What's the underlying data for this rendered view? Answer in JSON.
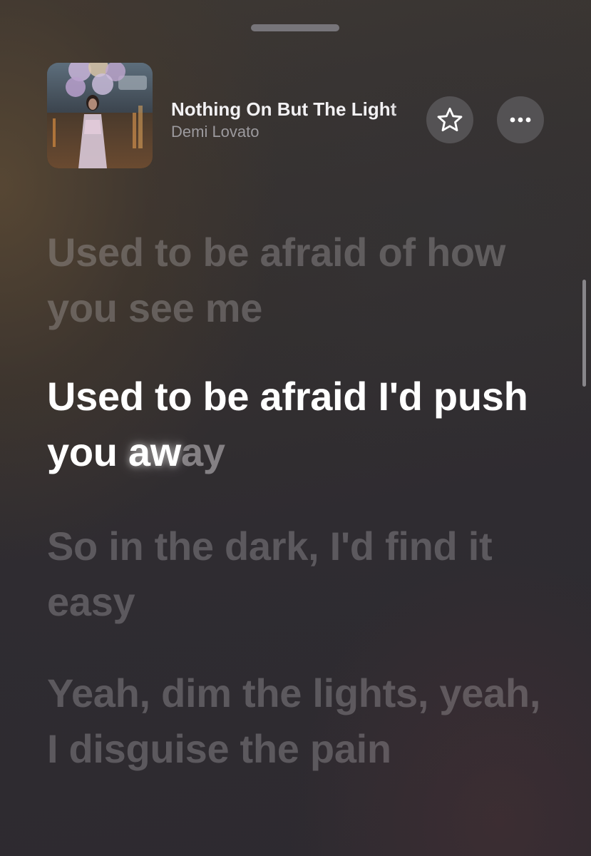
{
  "now_playing": {
    "title": "Nothing On But The Light",
    "artist": "Demi Lovato"
  },
  "icons": {
    "favorite": "star-icon",
    "more": "more-dots-icon"
  },
  "lyrics": [
    {
      "text": "Used to be afraid of how you see me",
      "state": "past"
    },
    {
      "sung": "Used to be afraid I'd push you ",
      "glowing": "aw",
      "pending": "ay",
      "state": "current"
    },
    {
      "text": "So in the dark, I'd find it easy",
      "state": "upcoming"
    },
    {
      "text": "Yeah, dim the lights, yeah, I disguise the pain",
      "state": "upcoming"
    }
  ]
}
